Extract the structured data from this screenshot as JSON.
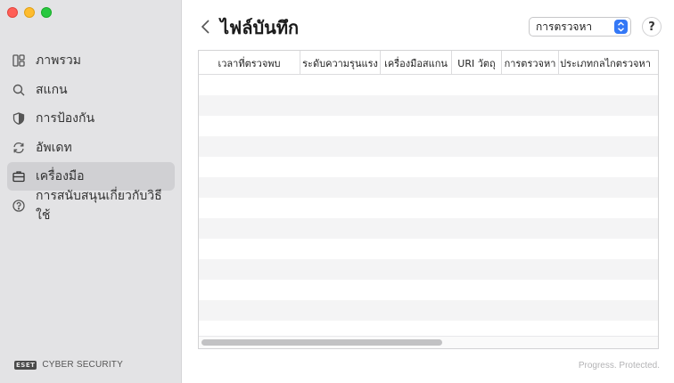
{
  "window": {
    "controls": [
      "close",
      "minimize",
      "maximize"
    ]
  },
  "sidebar": {
    "items": [
      {
        "label": "ภาพรวม",
        "icon": "overview-icon"
      },
      {
        "label": "สแกน",
        "icon": "search-icon"
      },
      {
        "label": "การป้องกัน",
        "icon": "shield-icon"
      },
      {
        "label": "อัพเดท",
        "icon": "refresh-icon"
      },
      {
        "label": "เครื่องมือ",
        "icon": "briefcase-icon",
        "active": true
      },
      {
        "label": "การสนับสนุนเกี่ยวกับวิธีใช้",
        "icon": "help-circle-icon"
      }
    ],
    "brand": {
      "logo": "eset",
      "name": "CYBER SECURITY"
    }
  },
  "header": {
    "title": "ไฟล์บันทึก",
    "filter_value": "การตรวจหา",
    "help_label": "?"
  },
  "table": {
    "columns": [
      "เวลาที่ตรวจพบ",
      "ระดับความรุนแรง",
      "เครื่องมือสแกน",
      "URI วัตถุ",
      "การตรวจหา",
      "ประเภทกลไกตรวจหา"
    ],
    "rows": []
  },
  "footer": {
    "tagline": "Progress. Protected."
  },
  "colors": {
    "accent": "#3478f6",
    "sidebar_bg": "#e3e3e5",
    "active_bg": "#d0d0d3"
  }
}
